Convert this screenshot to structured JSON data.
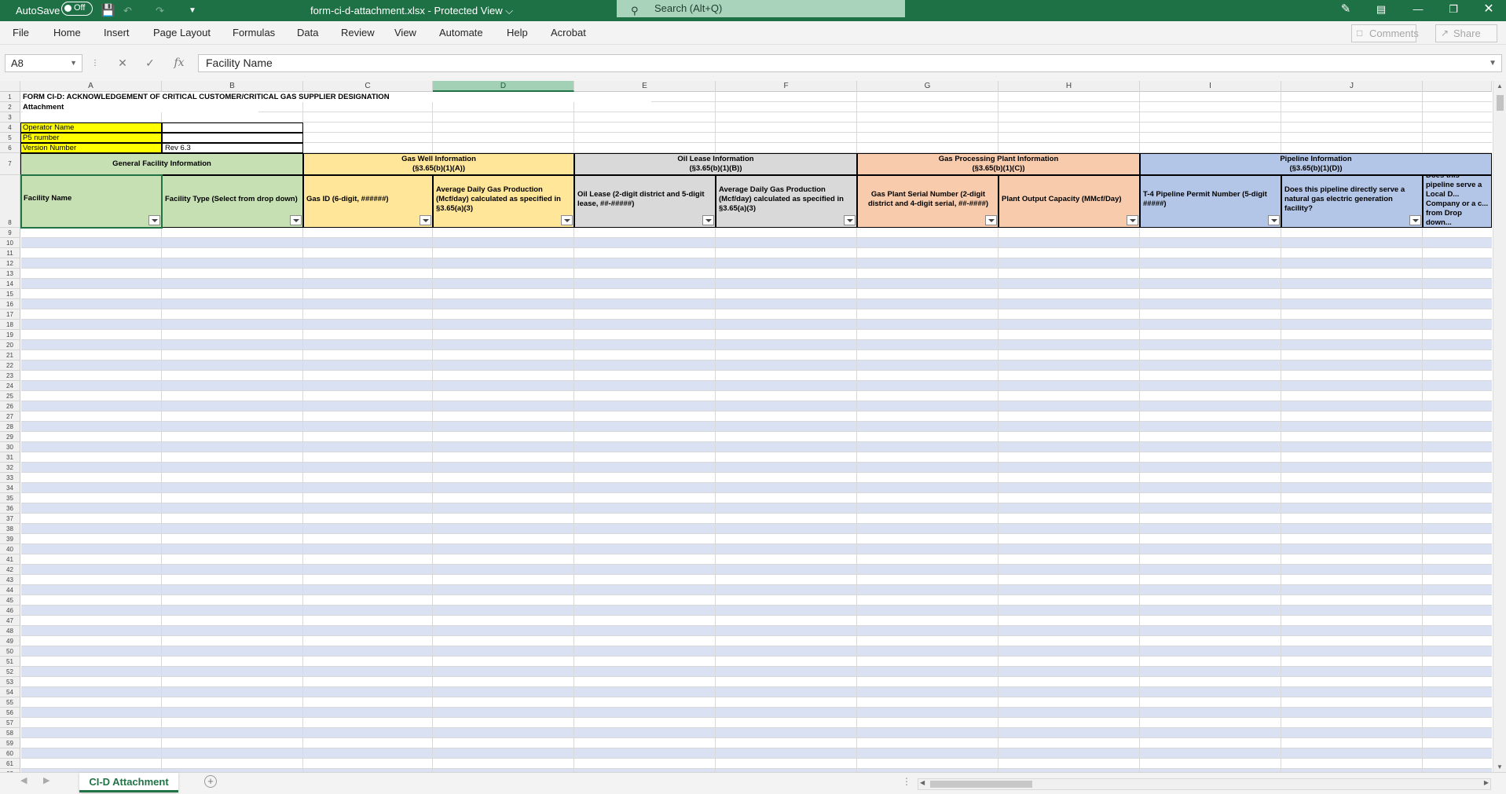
{
  "titlebar": {
    "autosave_label": "AutoSave",
    "autosave_state": "Off",
    "file_title": "form-ci-d-attachment.xlsx  -  Protected View ⌵",
    "search_placeholder": "Search (Alt+Q)"
  },
  "menu": {
    "items": [
      "File",
      "Home",
      "Insert",
      "Page Layout",
      "Formulas",
      "Data",
      "Review",
      "View",
      "Automate",
      "Help",
      "Acrobat"
    ],
    "comments": "Comments",
    "share": "Share"
  },
  "formula_bar": {
    "name_box": "A8",
    "fx": "fx",
    "formula": "Facility Name"
  },
  "columns": [
    "A",
    "B",
    "C",
    "D",
    "E",
    "F",
    "G",
    "H",
    "I",
    "J"
  ],
  "selected_column": "D",
  "row_numbers": [
    "1",
    "2",
    "3",
    "4",
    "5",
    "6",
    "7",
    "8",
    "9",
    "10",
    "11",
    "12",
    "13",
    "14",
    "15",
    "16",
    "17",
    "18",
    "19",
    "20",
    "21",
    "22",
    "23",
    "24",
    "25",
    "26",
    "27",
    "28",
    "29",
    "30",
    "31",
    "32",
    "33",
    "34",
    "35",
    "36",
    "37",
    "38",
    "39",
    "40",
    "41",
    "42",
    "43",
    "44",
    "45",
    "46",
    "47",
    "48",
    "49",
    "50",
    "51",
    "52",
    "53",
    "54",
    "55",
    "56",
    "57",
    "58",
    "59",
    "60",
    "61",
    "62"
  ],
  "sheet": {
    "title": "FORM CI-D: ACKNOWLEDGEMENT OF CRITICAL CUSTOMER/CRITICAL GAS SUPPLIER DESIGNATION",
    "subtitle": "Attachment",
    "operator_label": "Operator Name",
    "p5_label": "P5 number",
    "version_label": "Version Number",
    "version_value": "Rev 6.3",
    "group_general": "General Facility Information",
    "group_gaswell_1": "Gas Well Information",
    "group_gaswell_2": "(§3.65(b)(1)(A))",
    "group_oil_1": "Oil Lease Information",
    "group_oil_2": "(§3.65(b)(1)(B))",
    "group_plant_1": "Gas Processing Plant Information",
    "group_plant_2": "(§3.65(b)(1)(C))",
    "group_pipe_1": "Pipeline Information",
    "group_pipe_2": "(§3.65(b)(1)(D))",
    "h_a": "Facility Name",
    "h_b": "Facility Type (Select from drop down)",
    "h_c": "Gas ID (6-digit, ######)",
    "h_d": "Average Daily Gas Production (Mcf/day) calculated as specified in §3.65(a)(3)",
    "h_e": "Oil Lease (2-digit district and 5-digit lease, ##-#####)",
    "h_f": "Average Daily Gas Production (Mcf/day) calculated as specified in  §3.65(a)(3)",
    "h_g": "Gas Plant Serial Number (2-digit district and 4-digit serial, ##-####)",
    "h_h": "Plant Output Capacity (MMcf/Day)",
    "h_i": "T-4 Pipeline Permit Number (5-digit #####)",
    "h_j": "Does this pipeline directly serve a natural gas electric generation facility?",
    "h_k": "Does this pipeline serve a Local D... Company or a c... from Drop down..."
  },
  "sheet_tab": "CI-D Attachment",
  "colors": {
    "excel_green": "#1e7145",
    "general_green": "#c6e0b4",
    "gaswell_yellow": "#ffe699",
    "oil_gray": "#d9d9d9",
    "plant_orange": "#f8cbad",
    "pipeline_blue": "#b4c6e7",
    "label_yellow": "#ffff00",
    "stripe_blue": "#d9e1f2"
  }
}
